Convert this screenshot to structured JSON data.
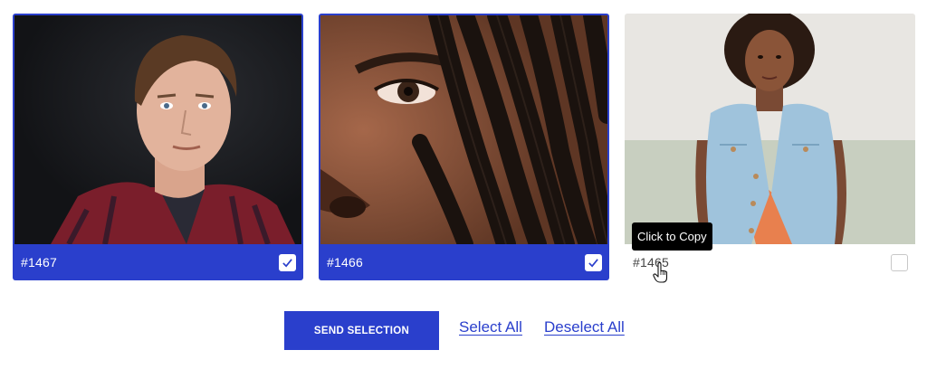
{
  "cards": [
    {
      "number": "#1467",
      "selected": true,
      "photo": "portrait-man-plaid-shirt"
    },
    {
      "number": "#1466",
      "selected": true,
      "photo": "closeup-face-dreadlocks"
    },
    {
      "number": "#1465",
      "selected": false,
      "photo": "woman-denim-vest-orange-top"
    }
  ],
  "tooltip": {
    "text": "Click to Copy"
  },
  "actions": {
    "send_label": "SEND SELECTION",
    "select_all_label": "Select All",
    "deselect_all_label": "Deselect All"
  },
  "colors": {
    "accent": "#2a3fcc",
    "tooltip_bg": "#000000"
  },
  "icons": {
    "checked": "checkmark-icon",
    "cursor": "hand-pointer-icon"
  }
}
